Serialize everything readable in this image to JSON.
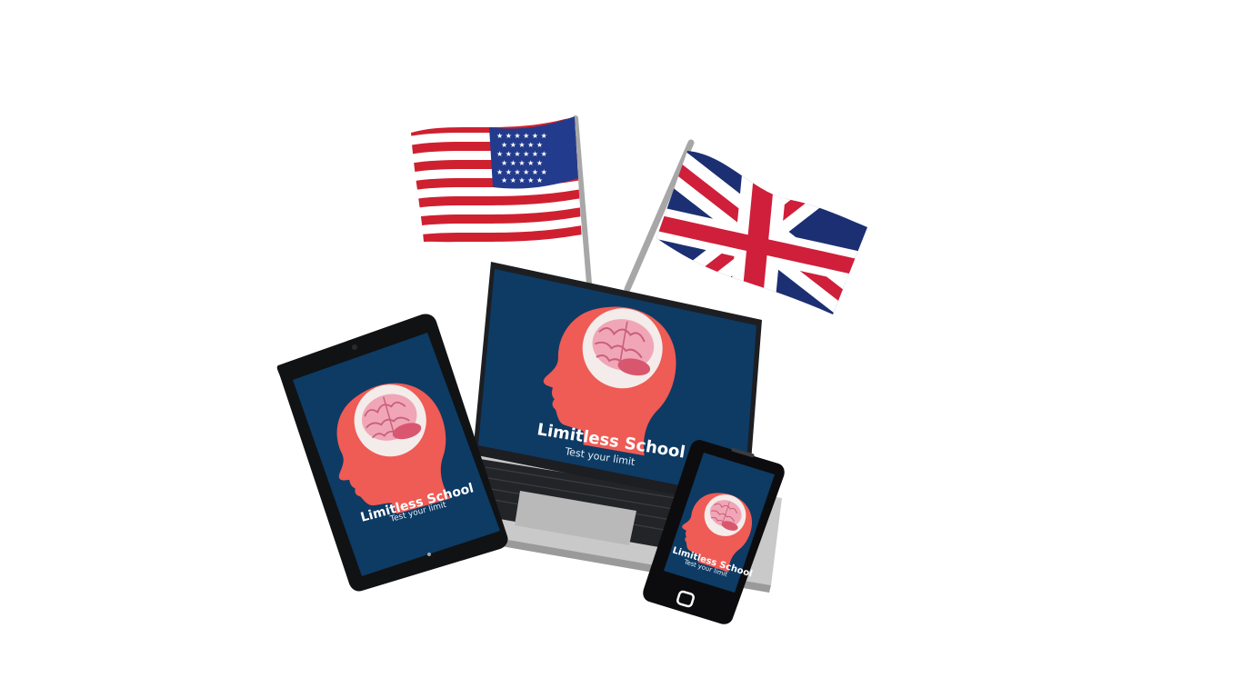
{
  "branding": {
    "title": "Limitless School",
    "tagline": "Test your limit"
  },
  "flags": [
    {
      "name": "us-flag-icon"
    },
    {
      "name": "uk-flag-icon"
    }
  ],
  "colors": {
    "background": "#ffffff",
    "screen_navy": "#0d3b64",
    "head_coral": "#ef5b55",
    "brain_pink": "#f0a6b7",
    "us_red": "#cf2030",
    "us_blue": "#233b8c",
    "uk_blue": "#1c2f73",
    "uk_red": "#cf1f3a"
  }
}
